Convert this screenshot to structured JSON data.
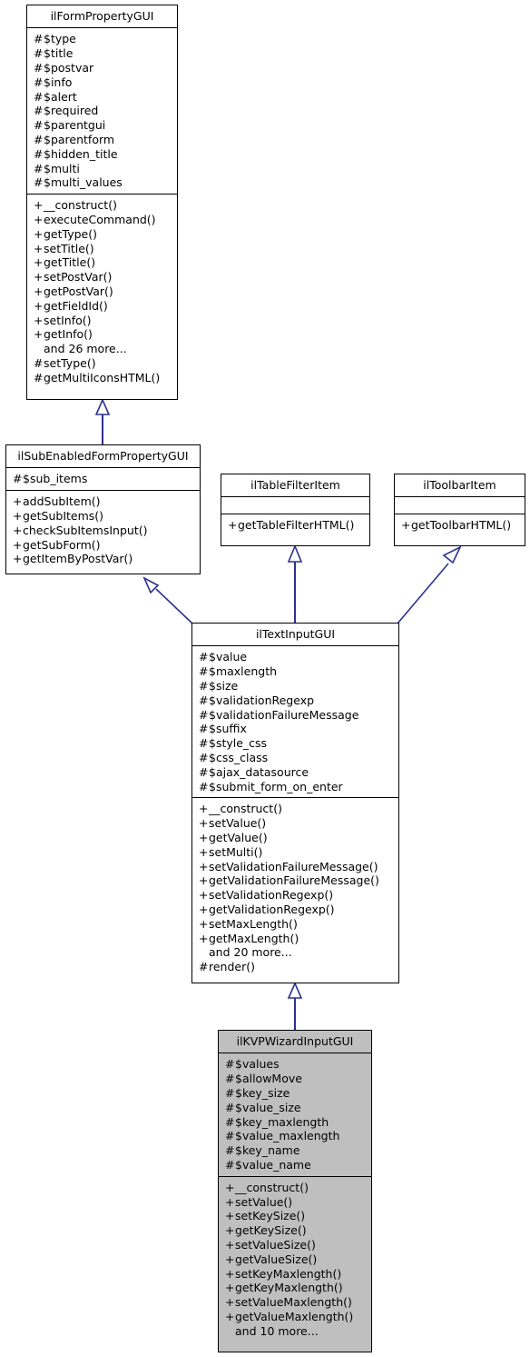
{
  "diagram": {
    "type": "uml-class-inheritance-diagram",
    "line_color": "#2e3191",
    "box_border_color": "#000000",
    "box_fill_color": "#ffffff",
    "highlight_fill_color": "#bfbfbf",
    "background_color": "#ffffff"
  },
  "classes": [
    {
      "id": "ilFormPropertyGUI",
      "name": "ilFormPropertyGUI",
      "highlighted": false,
      "attributes": [
        {
          "visibility": "#",
          "label": "$type"
        },
        {
          "visibility": "#",
          "label": "$title"
        },
        {
          "visibility": "#",
          "label": "$postvar"
        },
        {
          "visibility": "#",
          "label": "$info"
        },
        {
          "visibility": "#",
          "label": "$alert"
        },
        {
          "visibility": "#",
          "label": "$required"
        },
        {
          "visibility": "#",
          "label": "$parentgui"
        },
        {
          "visibility": "#",
          "label": "$parentform"
        },
        {
          "visibility": "#",
          "label": "$hidden_title"
        },
        {
          "visibility": "#",
          "label": "$multi"
        },
        {
          "visibility": "#",
          "label": "$multi_values"
        }
      ],
      "operations": [
        {
          "visibility": "+",
          "label": "__construct()"
        },
        {
          "visibility": "+",
          "label": "executeCommand()"
        },
        {
          "visibility": "+",
          "label": "getType()"
        },
        {
          "visibility": "+",
          "label": "setTitle()"
        },
        {
          "visibility": "+",
          "label": "getTitle()"
        },
        {
          "visibility": "+",
          "label": "setPostVar()"
        },
        {
          "visibility": "+",
          "label": "getPostVar()"
        },
        {
          "visibility": "+",
          "label": "getFieldId()"
        },
        {
          "visibility": "+",
          "label": "setInfo()"
        },
        {
          "visibility": "+",
          "label": "getInfo()"
        },
        {
          "visibility": "",
          "label": "and 26 more..."
        },
        {
          "visibility": "#",
          "label": "setType()"
        },
        {
          "visibility": "#",
          "label": "getMultiIconsHTML()"
        }
      ]
    },
    {
      "id": "ilSubEnabledFormPropertyGUI",
      "name": "ilSubEnabledFormPropertyGUI",
      "highlighted": false,
      "attributes": [
        {
          "visibility": "#",
          "label": "$sub_items"
        }
      ],
      "operations": [
        {
          "visibility": "+",
          "label": "addSubItem()"
        },
        {
          "visibility": "+",
          "label": "getSubItems()"
        },
        {
          "visibility": "+",
          "label": "checkSubItemsInput()"
        },
        {
          "visibility": "+",
          "label": "getSubForm()"
        },
        {
          "visibility": "+",
          "label": "getItemByPostVar()"
        }
      ]
    },
    {
      "id": "ilTableFilterItem",
      "name": "ilTableFilterItem",
      "highlighted": false,
      "attributes": [],
      "operations": [
        {
          "visibility": "+",
          "label": "getTableFilterHTML()"
        }
      ]
    },
    {
      "id": "ilToolbarItem",
      "name": "ilToolbarItem",
      "highlighted": false,
      "attributes": [],
      "operations": [
        {
          "visibility": "+",
          "label": "getToolbarHTML()"
        }
      ]
    },
    {
      "id": "ilTextInputGUI",
      "name": "ilTextInputGUI",
      "highlighted": false,
      "attributes": [
        {
          "visibility": "#",
          "label": "$value"
        },
        {
          "visibility": "#",
          "label": "$maxlength"
        },
        {
          "visibility": "#",
          "label": "$size"
        },
        {
          "visibility": "#",
          "label": "$validationRegexp"
        },
        {
          "visibility": "#",
          "label": "$validationFailureMessage"
        },
        {
          "visibility": "#",
          "label": "$suffix"
        },
        {
          "visibility": "#",
          "label": "$style_css"
        },
        {
          "visibility": "#",
          "label": "$css_class"
        },
        {
          "visibility": "#",
          "label": "$ajax_datasource"
        },
        {
          "visibility": "#",
          "label": "$submit_form_on_enter"
        }
      ],
      "operations": [
        {
          "visibility": "+",
          "label": "__construct()"
        },
        {
          "visibility": "+",
          "label": "setValue()"
        },
        {
          "visibility": "+",
          "label": "getValue()"
        },
        {
          "visibility": "+",
          "label": "setMulti()"
        },
        {
          "visibility": "+",
          "label": "setValidationFailureMessage()"
        },
        {
          "visibility": "+",
          "label": "getValidationFailureMessage()"
        },
        {
          "visibility": "+",
          "label": "setValidationRegexp()"
        },
        {
          "visibility": "+",
          "label": "getValidationRegexp()"
        },
        {
          "visibility": "+",
          "label": "setMaxLength()"
        },
        {
          "visibility": "+",
          "label": "getMaxLength()"
        },
        {
          "visibility": "",
          "label": "and 20 more..."
        },
        {
          "visibility": "#",
          "label": "render()"
        }
      ]
    },
    {
      "id": "ilKVPWizardInputGUI",
      "name": "ilKVPWizardInputGUI",
      "highlighted": true,
      "attributes": [
        {
          "visibility": "#",
          "label": "$values"
        },
        {
          "visibility": "#",
          "label": "$allowMove"
        },
        {
          "visibility": "#",
          "label": "$key_size"
        },
        {
          "visibility": "#",
          "label": "$value_size"
        },
        {
          "visibility": "#",
          "label": "$key_maxlength"
        },
        {
          "visibility": "#",
          "label": "$value_maxlength"
        },
        {
          "visibility": "#",
          "label": "$key_name"
        },
        {
          "visibility": "#",
          "label": "$value_name"
        }
      ],
      "operations": [
        {
          "visibility": "+",
          "label": "__construct()"
        },
        {
          "visibility": "+",
          "label": "setValue()"
        },
        {
          "visibility": "+",
          "label": "setKeySize()"
        },
        {
          "visibility": "+",
          "label": "getKeySize()"
        },
        {
          "visibility": "+",
          "label": "setValueSize()"
        },
        {
          "visibility": "+",
          "label": "getValueSize()"
        },
        {
          "visibility": "+",
          "label": "setKeyMaxlength()"
        },
        {
          "visibility": "+",
          "label": "getKeyMaxlength()"
        },
        {
          "visibility": "+",
          "label": "setValueMaxlength()"
        },
        {
          "visibility": "+",
          "label": "getValueMaxlength()"
        },
        {
          "visibility": "",
          "label": "and 10 more..."
        }
      ]
    }
  ],
  "relations": [
    {
      "from": "ilSubEnabledFormPropertyGUI",
      "to": "ilFormPropertyGUI",
      "kind": "inheritance"
    },
    {
      "from": "ilTextInputGUI",
      "to": "ilSubEnabledFormPropertyGUI",
      "kind": "inheritance"
    },
    {
      "from": "ilTextInputGUI",
      "to": "ilTableFilterItem",
      "kind": "inheritance"
    },
    {
      "from": "ilTextInputGUI",
      "to": "ilToolbarItem",
      "kind": "inheritance"
    },
    {
      "from": "ilKVPWizardInputGUI",
      "to": "ilTextInputGUI",
      "kind": "inheritance"
    }
  ]
}
